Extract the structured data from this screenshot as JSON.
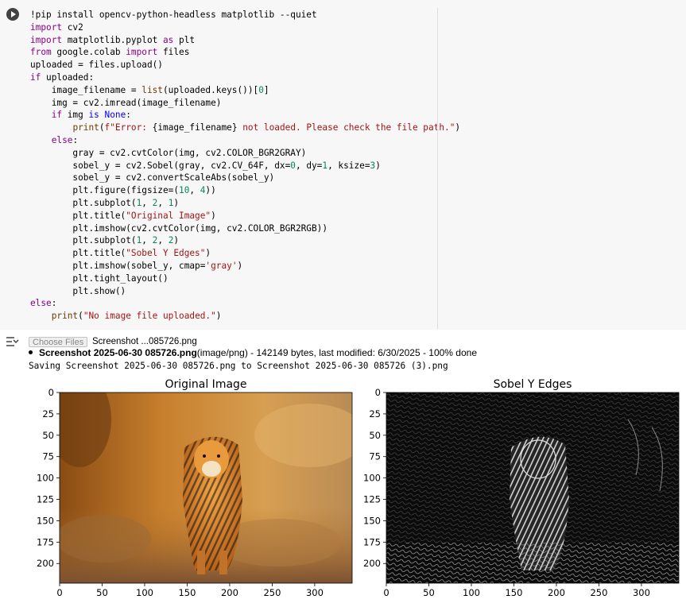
{
  "cell": {
    "code_lines": [
      [
        [
          "op",
          "!pip install opencv-python-headless matplotlib --quiet"
        ]
      ],
      [
        [
          "kw",
          "import"
        ],
        [
          "op",
          " cv2"
        ]
      ],
      [
        [
          "kw",
          "import"
        ],
        [
          "op",
          " matplotlib.pyplot "
        ],
        [
          "kw",
          "as"
        ],
        [
          "op",
          " plt"
        ]
      ],
      [
        [
          "kw",
          "from"
        ],
        [
          "op",
          " google.colab "
        ],
        [
          "kw",
          "import"
        ],
        [
          "op",
          " files"
        ]
      ],
      [
        [
          "op",
          "uploaded = files.upload()"
        ]
      ],
      [
        [
          "kw",
          "if"
        ],
        [
          "op",
          " uploaded:"
        ]
      ],
      [
        [
          "op",
          "    image_filename = "
        ],
        [
          "fn",
          "list"
        ],
        [
          "op",
          "(uploaded.keys())["
        ],
        [
          "num",
          "0"
        ],
        [
          "op",
          "]"
        ]
      ],
      [
        [
          "op",
          "    img = cv2.imread(image_filename)"
        ]
      ],
      [
        [
          "op",
          "    "
        ],
        [
          "kw",
          "if"
        ],
        [
          "op",
          " img "
        ],
        [
          "kw2",
          "is"
        ],
        [
          "op",
          " "
        ],
        [
          "kw2",
          "None"
        ],
        [
          "op",
          ":"
        ]
      ],
      [
        [
          "op",
          "        "
        ],
        [
          "fn",
          "print"
        ],
        [
          "op",
          "("
        ],
        [
          "str",
          "f\"Error: "
        ],
        [
          "op",
          "{image_filename}"
        ],
        [
          "str",
          " not loaded. Please check the file path.\""
        ],
        [
          "op",
          ")"
        ]
      ],
      [
        [
          "op",
          "    "
        ],
        [
          "kw",
          "else"
        ],
        [
          "op",
          ":"
        ]
      ],
      [
        [
          "op",
          "        gray = cv2.cvtColor(img, cv2.COLOR_BGR2GRAY)"
        ]
      ],
      [
        [
          "op",
          "        sobel_y = cv2.Sobel(gray, cv2.CV_64F, dx="
        ],
        [
          "num",
          "0"
        ],
        [
          "op",
          ", dy="
        ],
        [
          "num",
          "1"
        ],
        [
          "op",
          ", ksize="
        ],
        [
          "num",
          "3"
        ],
        [
          "op",
          ")"
        ]
      ],
      [
        [
          "op",
          "        sobel_y = cv2.convertScaleAbs(sobel_y)"
        ]
      ],
      [
        [
          "op",
          "        plt.figure(figsize=("
        ],
        [
          "num",
          "10"
        ],
        [
          "op",
          ", "
        ],
        [
          "num",
          "4"
        ],
        [
          "op",
          "))"
        ]
      ],
      [
        [
          "op",
          "        plt.subplot("
        ],
        [
          "num",
          "1"
        ],
        [
          "op",
          ", "
        ],
        [
          "num",
          "2"
        ],
        [
          "op",
          ", "
        ],
        [
          "num",
          "1"
        ],
        [
          "op",
          ")"
        ]
      ],
      [
        [
          "op",
          "        plt.title("
        ],
        [
          "str",
          "\"Original Image\""
        ],
        [
          "op",
          ")"
        ]
      ],
      [
        [
          "op",
          "        plt.imshow(cv2.cvtColor(img, cv2.COLOR_BGR2RGB))"
        ]
      ],
      [
        [
          "op",
          "        plt.subplot("
        ],
        [
          "num",
          "1"
        ],
        [
          "op",
          ", "
        ],
        [
          "num",
          "2"
        ],
        [
          "op",
          ", "
        ],
        [
          "num",
          "2"
        ],
        [
          "op",
          ")"
        ]
      ],
      [
        [
          "op",
          "        plt.title("
        ],
        [
          "str",
          "\"Sobel Y Edges\""
        ],
        [
          "op",
          ")"
        ]
      ],
      [
        [
          "op",
          "        plt.imshow(sobel_y, cmap="
        ],
        [
          "str",
          "'gray'"
        ],
        [
          "op",
          ")"
        ]
      ],
      [
        [
          "op",
          "        plt.tight_layout()"
        ]
      ],
      [
        [
          "op",
          "        plt.show()"
        ]
      ],
      [
        [
          "kw",
          "else"
        ],
        [
          "op",
          ":"
        ]
      ],
      [
        [
          "op",
          "    "
        ],
        [
          "fn",
          "print"
        ],
        [
          "op",
          "("
        ],
        [
          "str",
          "\"No image file uploaded.\""
        ],
        [
          "op",
          ")"
        ]
      ]
    ]
  },
  "output": {
    "choose_button": "Choose Files",
    "chosen_file": "Screenshot ...085726.png",
    "upload_item": {
      "name": "Screenshot 2025-06-30 085726.png",
      "details": "(image/png) - 142149 bytes, last modified: 6/30/2025 - 100% done"
    },
    "saving_line": "Saving Screenshot 2025-06-30 085726.png to Screenshot 2025-06-30 085726 (3).png"
  },
  "chart_data": [
    {
      "type": "image",
      "title": "Original Image",
      "xticks": [
        0,
        50,
        100,
        150,
        200,
        250,
        300
      ],
      "yticks": [
        0,
        25,
        50,
        75,
        100,
        125,
        150,
        175,
        200
      ],
      "xlim": [
        0,
        344
      ],
      "ylim": [
        223,
        0
      ]
    },
    {
      "type": "image",
      "title": "Sobel Y Edges",
      "xticks": [
        0,
        50,
        100,
        150,
        200,
        250,
        300
      ],
      "yticks": [
        0,
        25,
        50,
        75,
        100,
        125,
        150,
        175,
        200
      ],
      "xlim": [
        0,
        344
      ],
      "ylim": [
        223,
        0
      ],
      "colormap": "gray"
    }
  ]
}
